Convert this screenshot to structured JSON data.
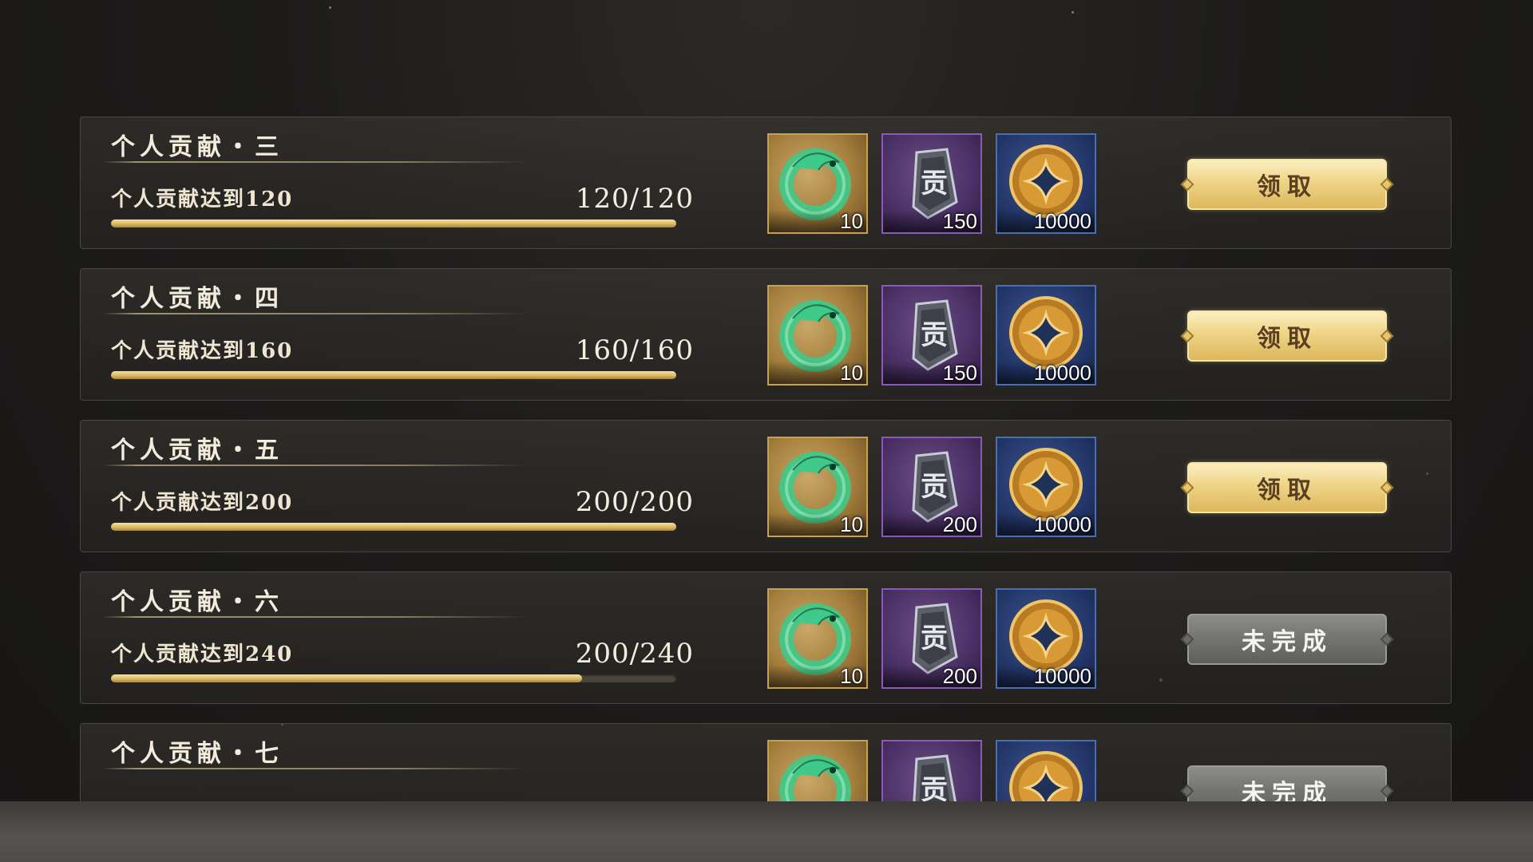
{
  "tasks": [
    {
      "title": "个人贡献・三",
      "requirement": "个人贡献达到120",
      "progress_text": "120/120",
      "progress": 1.0,
      "rewards": [
        {
          "icon": "jade-dragon-ring-icon",
          "qty": "10"
        },
        {
          "icon": "contribution-token-icon",
          "qty": "150"
        },
        {
          "icon": "gold-coin-icon",
          "qty": "10000"
        }
      ],
      "button": {
        "label": "领取",
        "state": "claim"
      }
    },
    {
      "title": "个人贡献・四",
      "requirement": "个人贡献达到160",
      "progress_text": "160/160",
      "progress": 1.0,
      "rewards": [
        {
          "icon": "jade-dragon-ring-icon",
          "qty": "10"
        },
        {
          "icon": "contribution-token-icon",
          "qty": "150"
        },
        {
          "icon": "gold-coin-icon",
          "qty": "10000"
        }
      ],
      "button": {
        "label": "领取",
        "state": "claim"
      }
    },
    {
      "title": "个人贡献・五",
      "requirement": "个人贡献达到200",
      "progress_text": "200/200",
      "progress": 1.0,
      "rewards": [
        {
          "icon": "jade-dragon-ring-icon",
          "qty": "10"
        },
        {
          "icon": "contribution-token-icon",
          "qty": "200"
        },
        {
          "icon": "gold-coin-icon",
          "qty": "10000"
        }
      ],
      "button": {
        "label": "领取",
        "state": "claim"
      }
    },
    {
      "title": "个人贡献・六",
      "requirement": "个人贡献达到240",
      "progress_text": "200/240",
      "progress": 0.833,
      "rewards": [
        {
          "icon": "jade-dragon-ring-icon",
          "qty": "10"
        },
        {
          "icon": "contribution-token-icon",
          "qty": "200"
        },
        {
          "icon": "gold-coin-icon",
          "qty": "10000"
        }
      ],
      "button": {
        "label": "未完成",
        "state": "incomplete"
      }
    },
    {
      "title": "个人贡献・七",
      "requirement": "",
      "progress_text": "",
      "progress": 0,
      "rewards": [
        {
          "icon": "jade-dragon-ring-icon",
          "qty": ""
        },
        {
          "icon": "contribution-token-icon",
          "qty": ""
        },
        {
          "icon": "gold-coin-icon",
          "qty": ""
        }
      ],
      "button": {
        "label": "未完成",
        "state": "incomplete"
      }
    }
  ],
  "token_glyph": "贡",
  "colors": {
    "accent_gold": "#dcb75c",
    "incomplete_grey": "#737372",
    "jade": "#3fc98a",
    "token_purple": "#4a3064",
    "coin_blue": "#24376a"
  }
}
